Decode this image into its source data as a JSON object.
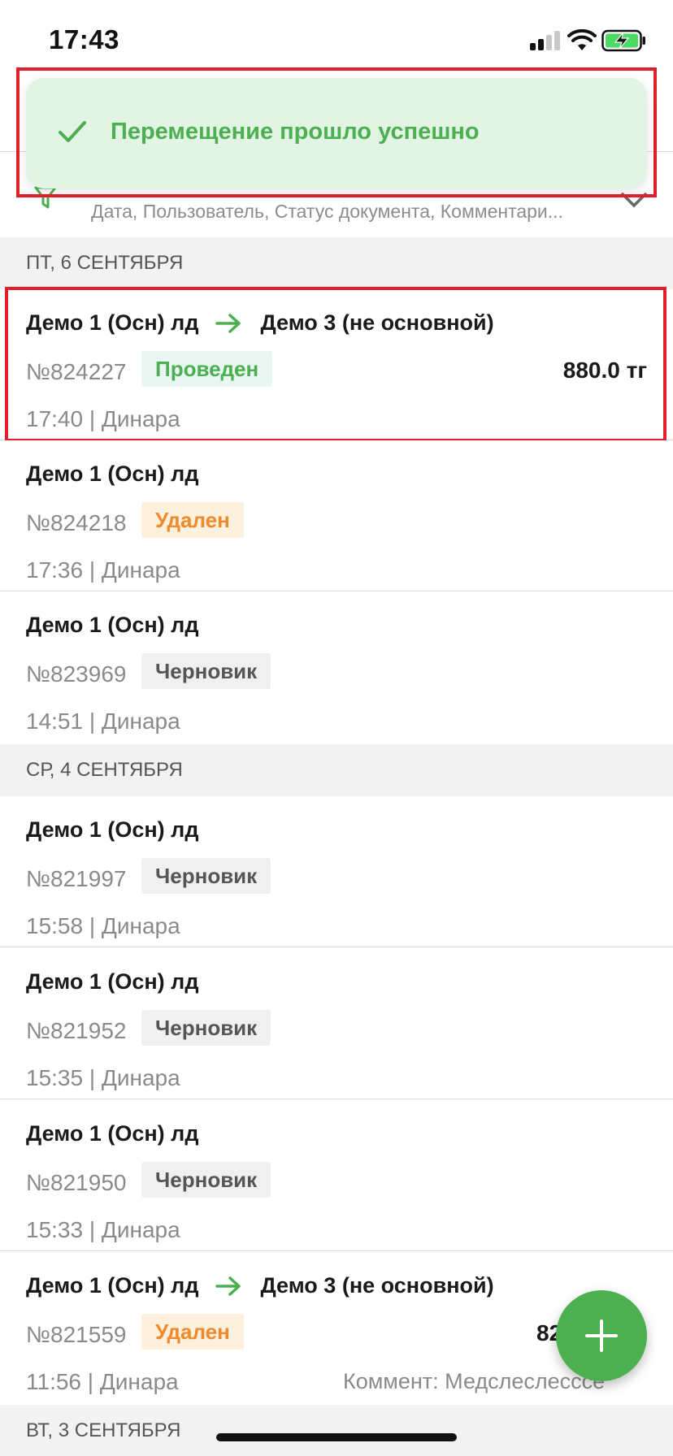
{
  "status_bar": {
    "time": "17:43",
    "icons": [
      "signal-icon",
      "wifi-icon",
      "battery-charging-icon"
    ]
  },
  "filter": {
    "subtitle": "Дата, Пользователь, Статус документа, Комментари..."
  },
  "toast": {
    "message": "Перемещение прошло успешно",
    "icon": "check-icon",
    "background": "#e2f5e4",
    "color": "#4caf50"
  },
  "groups": [
    {
      "date": "ПТ, 6 СЕНТЯБРЯ",
      "docs": [
        {
          "from": "Демо 1 (Осн) лд",
          "to": "Демо 3 (не основной)",
          "number": "№824227",
          "status": "Проведен",
          "sum": "880.0 тг",
          "meta": "17:40 | Динара"
        },
        {
          "from": "Демо 1 (Осн) лд",
          "number": "№824218",
          "status": "Удален",
          "meta": "17:36 | Динара"
        },
        {
          "from": "Демо 1 (Осн) лд",
          "number": "№823969",
          "status": "Черновик",
          "meta": "14:51 | Динара"
        }
      ]
    },
    {
      "date": "СР, 4 СЕНТЯБРЯ",
      "docs": [
        {
          "from": "Демо 1 (Осн) лд",
          "number": "№821997",
          "status": "Черновик",
          "meta": "15:58 | Динара"
        },
        {
          "from": "Демо 1 (Осн) лд",
          "number": "№821952",
          "status": "Черновик",
          "meta": "15:35 | Динара"
        },
        {
          "from": "Демо 1 (Осн) лд",
          "number": "№821950",
          "status": "Черновик",
          "meta": "15:33 | Динара"
        },
        {
          "from": "Демо 1 (Осн) лд",
          "to": "Демо 3 (не основной)",
          "number": "№821559",
          "status": "Удален",
          "sum": "82",
          "meta": "11:56 | Динара",
          "comment": "Коммент: Медслеслесссе"
        }
      ]
    },
    {
      "date": "ВТ, 3 СЕНТЯБРЯ",
      "docs": []
    }
  ],
  "colors": {
    "accent": "#4caf50",
    "deleted": "#ef8a2c",
    "highlight": "#e01f2d"
  },
  "fab": {
    "icon": "plus-icon"
  }
}
